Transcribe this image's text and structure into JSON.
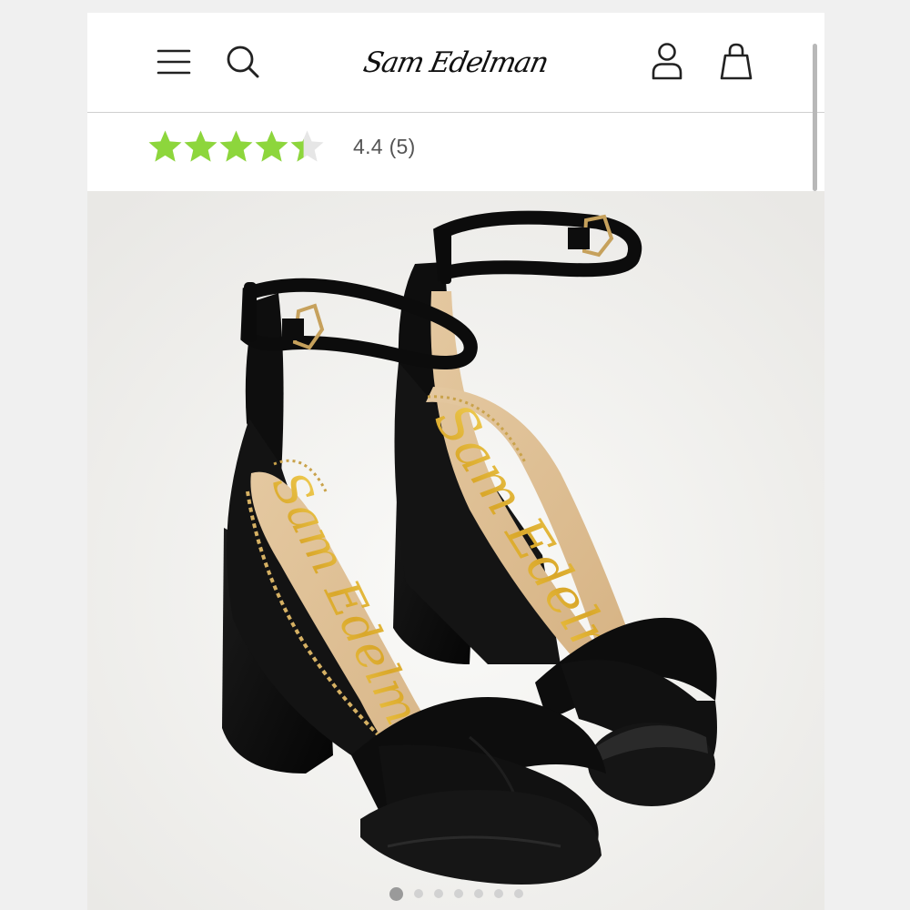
{
  "header": {
    "brand_logo": "Sam Edelman",
    "menu_icon": "hamburger-menu-icon",
    "search_icon": "search-icon",
    "account_icon": "user-account-icon",
    "bag_icon": "shopping-bag-icon"
  },
  "rating": {
    "value": 4.4,
    "max": 5,
    "text": "4.4 (5)",
    "star_color": "#8dd63c",
    "empty_star_color": "#e6e6e6"
  },
  "product_image": {
    "insole_logo": "Sam Edelman",
    "carousel_total": 7,
    "carousel_active": 1
  }
}
